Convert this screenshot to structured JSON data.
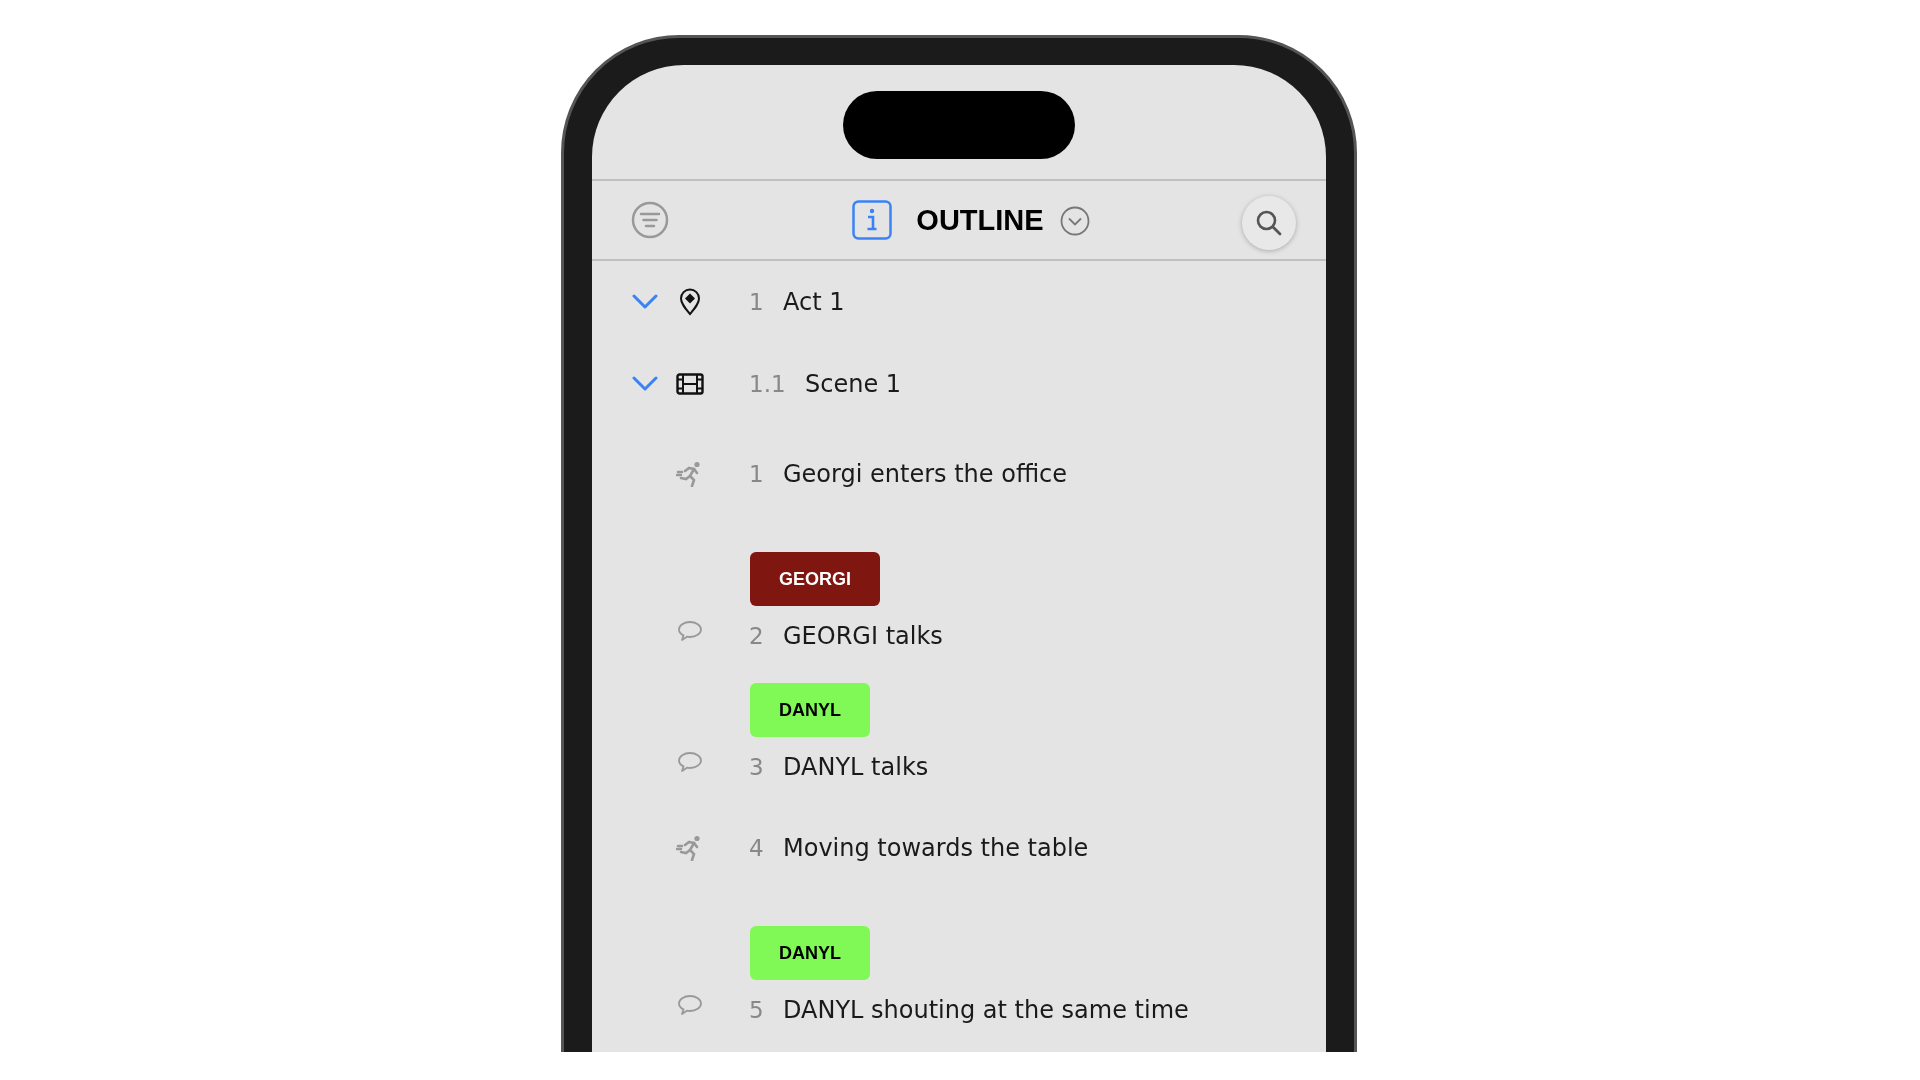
{
  "header": {
    "title": "OUTLINE"
  },
  "outline": [
    {
      "kind": "act",
      "number": "1",
      "title": "Act 1",
      "expanded": true,
      "children": [
        {
          "kind": "scene",
          "number": "1.1",
          "title": "Scene 1",
          "expanded": true,
          "children": [
            {
              "kind": "action",
              "number": "1",
              "title": "Georgi enters the office"
            },
            {
              "kind": "dialogue",
              "character": {
                "name": "GEORGI",
                "color": "#7f1610"
              },
              "number": "2",
              "title": "GEORGI talks"
            },
            {
              "kind": "dialogue",
              "character": {
                "name": "DANYL",
                "color": "#80f855"
              },
              "number": "3",
              "title": "DANYL talks"
            },
            {
              "kind": "action",
              "number": "4",
              "title": "Moving towards the table"
            },
            {
              "kind": "dialogue",
              "character": {
                "name": "DANYL",
                "color": "#80f855"
              },
              "number": "5",
              "title": "DANYL shouting at the same time"
            }
          ]
        }
      ]
    }
  ]
}
